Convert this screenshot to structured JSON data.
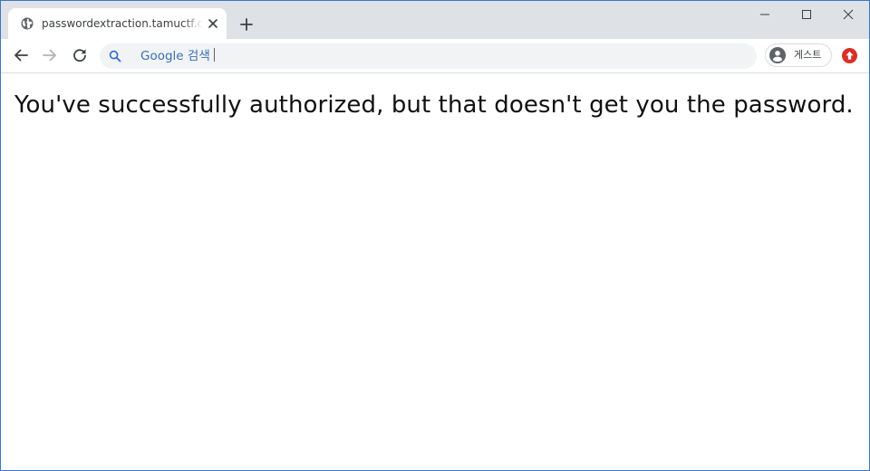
{
  "browser": {
    "tab": {
      "title": "passwordextraction.tamuctf.com",
      "favicon": "globe-icon",
      "close_icon": "close-icon"
    },
    "new_tab_icon": "plus-icon",
    "window_controls": [
      "minimize-icon",
      "maximize-icon",
      "close-icon"
    ],
    "toolbar": {
      "back_icon": "arrow-left-icon",
      "forward_icon": "arrow-right-icon",
      "reload_icon": "reload-icon",
      "omnibox": {
        "search_icon": "search-icon",
        "placeholder": "Google 검색"
      },
      "profile": {
        "avatar": "person-icon",
        "label": "게스트"
      },
      "update_icon": "update-arrow-icon"
    },
    "colors": {
      "tabstrip": "#dee1e6",
      "omnibox": "#f1f3f4",
      "omnibox_text": "#3b6fb6",
      "update_badge": "#d93025",
      "window_border": "#3b78c4"
    }
  },
  "page": {
    "message": "You've successfully authorized, but that doesn't get you the password."
  }
}
